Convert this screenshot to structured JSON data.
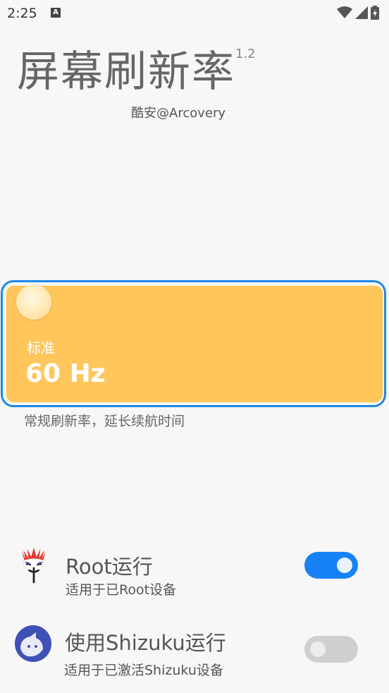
{
  "status_bar": {
    "time": "2:25",
    "notification_icon_letter": "A",
    "icons": [
      "wifi-icon",
      "signal-icon",
      "battery-charging-icon"
    ]
  },
  "header": {
    "title": "屏幕刷新率",
    "version": "1.2",
    "author": "酷安@Arcovery"
  },
  "refresh_card": {
    "mode": "标准",
    "rate": "60 Hz",
    "description": "常规刷新率，延长续航时间",
    "color": "#ffc65c",
    "outline_color": "#1e88e5"
  },
  "options": [
    {
      "title": "Root运行",
      "subtitle": "适用于已Root设备",
      "icon": "magisk-icon",
      "enabled": true
    },
    {
      "title": "使用Shizuku运行",
      "subtitle": "适用于已激活Shizuku设备",
      "icon": "shizuku-icon",
      "enabled": false
    }
  ],
  "colors": {
    "accent": "#1682f5",
    "toggle_off": "#cfcfcf",
    "background": "#f7f7f7"
  }
}
